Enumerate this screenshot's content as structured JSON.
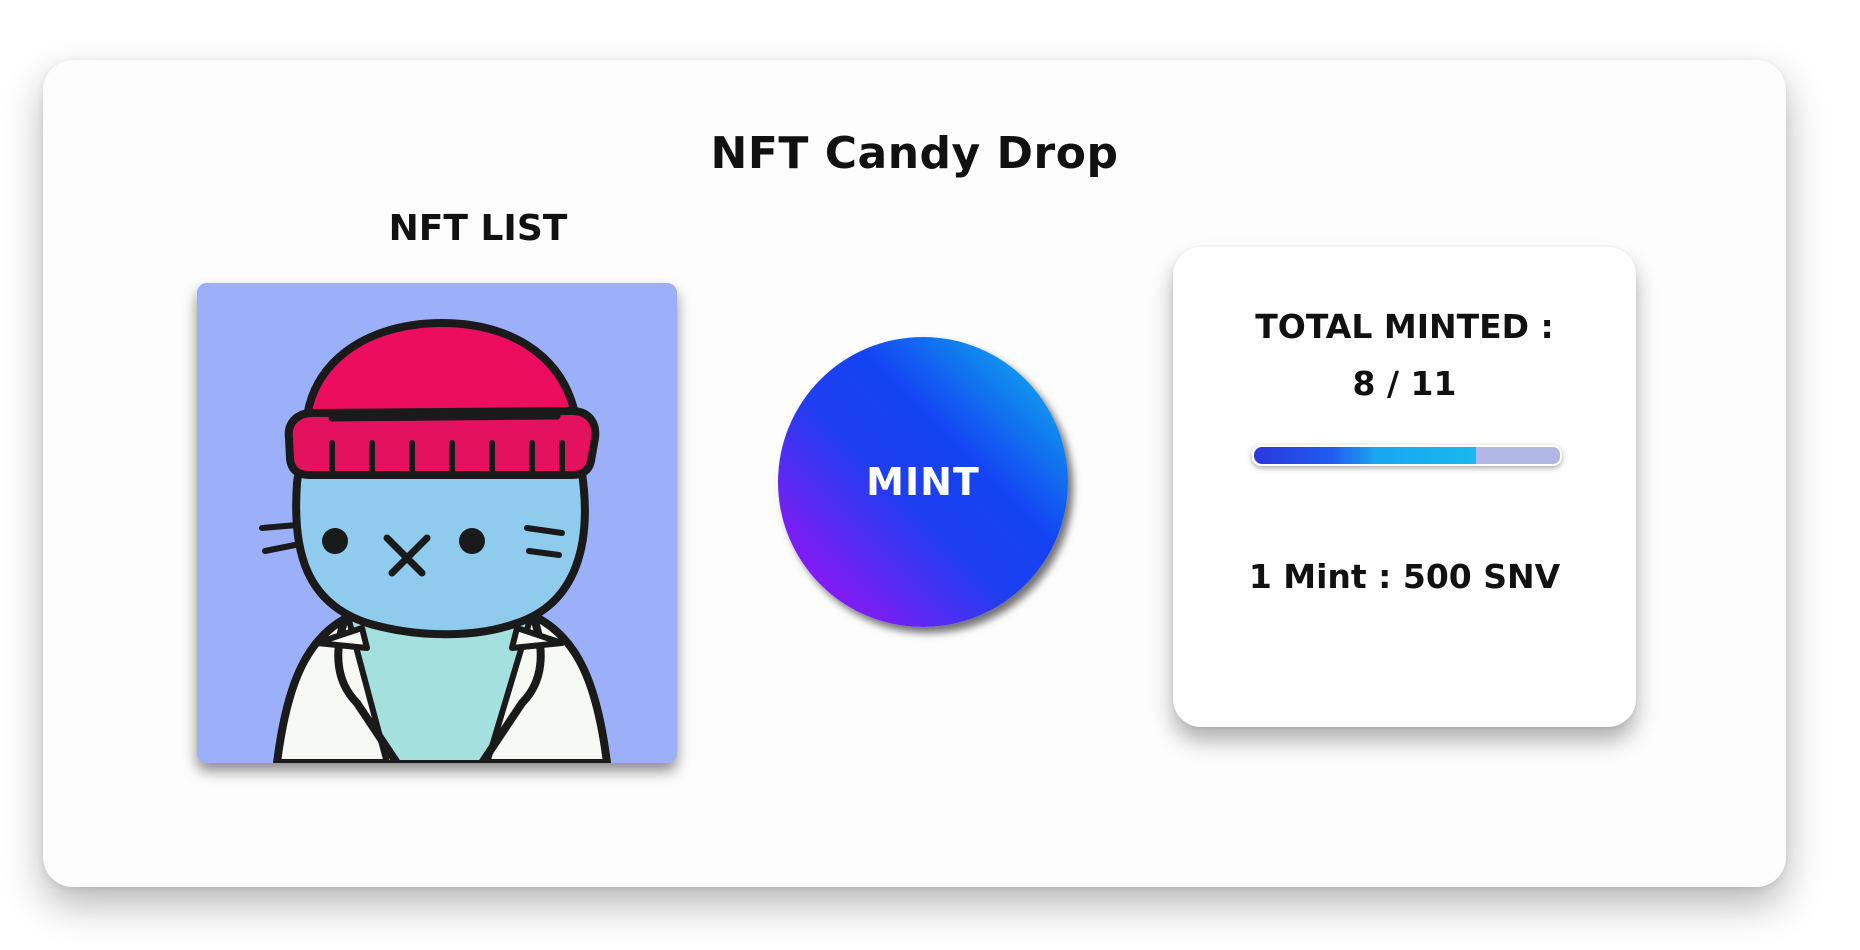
{
  "app": {
    "title": "NFT Candy Drop"
  },
  "nft_list": {
    "title": "NFT LIST",
    "image_icon": "cat-beanie-nft-icon"
  },
  "mint": {
    "label": "MINT"
  },
  "stats": {
    "total_label": "TOTAL MINTED :",
    "count_text": "8 / 11",
    "minted": 8,
    "total": 11,
    "progress_fraction": 0.727,
    "price_text": "1 Mint : 500 SNV"
  },
  "colors": {
    "nft_background": "#9cb0f9",
    "mint_gradient_start": "#10c4ec",
    "mint_gradient_mid": "#1443f3",
    "mint_gradient_end": "#9a11f5",
    "progress_track": "#b1b8e6"
  }
}
